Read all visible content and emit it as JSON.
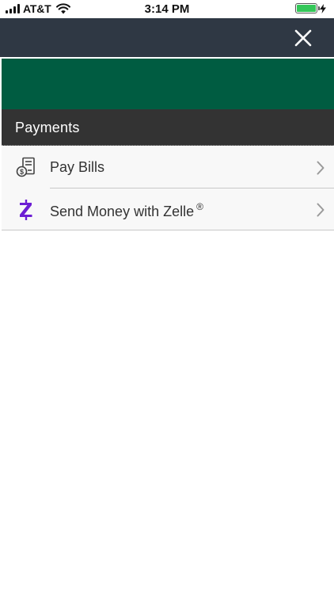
{
  "status": {
    "carrier": "AT&T",
    "time": "3:14 PM"
  },
  "nav": {
    "close_icon": "close-icon"
  },
  "colors": {
    "nav_bg": "#2f3844",
    "banner": "#005c41",
    "section_header": "#333333",
    "zelle": "#6d1ed4",
    "battery": "#34c759"
  },
  "section": {
    "title": "Payments"
  },
  "menu": {
    "items": [
      {
        "label": "Pay Bills",
        "icon": "bill-icon"
      },
      {
        "label": "Send Money with Zelle",
        "trademark": "®",
        "icon": "zelle-icon"
      }
    ]
  }
}
